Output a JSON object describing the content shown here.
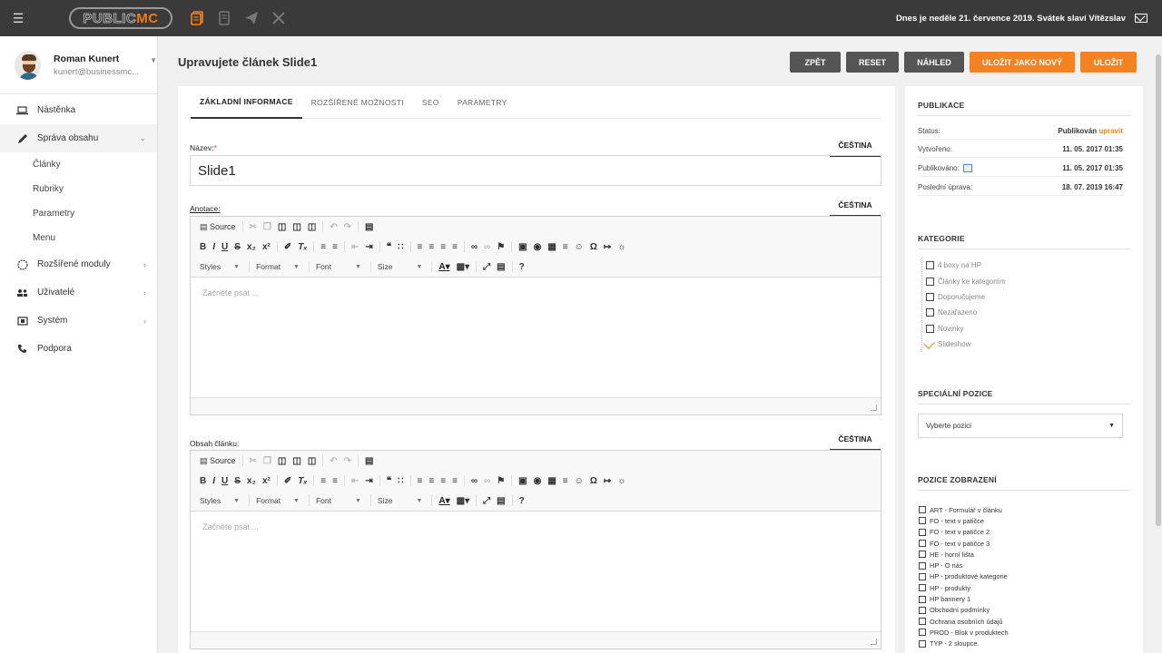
{
  "topbar": {
    "logo_part1": "PUBLIC",
    "logo_part2": "MC",
    "date_text": "Dnes je neděle 21. července 2019. Svátek slaví Vítězslav",
    "accent": "#f58220"
  },
  "user": {
    "name": "Roman Kunert",
    "email": "kunert@businessmc..."
  },
  "sidebar": {
    "items": [
      {
        "label": "Nástěnka",
        "icon": "laptop-icon"
      },
      {
        "label": "Správa obsahu",
        "icon": "pencil-icon"
      },
      {
        "label": "Rozšířené moduly",
        "icon": "modules-icon"
      },
      {
        "label": "Uživatelé",
        "icon": "users-icon"
      },
      {
        "label": "Systém",
        "icon": "system-icon"
      },
      {
        "label": "Podpora",
        "icon": "phone-icon"
      }
    ],
    "subitems": [
      "Články",
      "Rubriky",
      "Parametry",
      "Menu"
    ]
  },
  "header": {
    "title": "Upravujete článek Slide1",
    "buttons": {
      "back": "ZPĚT",
      "reset": "RESET",
      "preview": "NÁHLED",
      "save_new": "ULOŽIT JAKO NOVÝ",
      "save": "ULOŽIT"
    }
  },
  "tabs": [
    "ZÁKLADNÍ INFORMACE",
    "ROZŠÍŘENÉ MOŽNOSTI",
    "SEO",
    "PARAMETRY"
  ],
  "form": {
    "name_label": "Název:",
    "name_required": "*",
    "name_value": "Slide1",
    "annotation_label": "Anotace:",
    "content_label": "Obsah článku:",
    "language": "ČEŠTINA",
    "editor_placeholder": "Začněte psát ...",
    "toolbar": {
      "source": "Source",
      "styles": "Styles",
      "format": "Format",
      "font": "Font",
      "size": "Size"
    }
  },
  "publication": {
    "heading": "PUBLIKACE",
    "status_label": "Status:",
    "status_value": "Publikován",
    "status_link": "upravit",
    "created_label": "Vytvořeno:",
    "created_value": "11. 05. 2017 01:35",
    "published_label": "Publikováno:",
    "published_value": "11. 05. 2017 01:35",
    "modified_label": "Poslední úprava:",
    "modified_value": "18. 07. 2019 16:47"
  },
  "categories": {
    "heading": "KATEGORIE",
    "items": [
      {
        "label": "4 boxy na HP",
        "checked": false
      },
      {
        "label": "Články ke kategoriím",
        "checked": false
      },
      {
        "label": "Doporučujeme",
        "checked": false
      },
      {
        "label": "Nezařazeno",
        "checked": false
      },
      {
        "label": "Novinky",
        "checked": false
      },
      {
        "label": "Slideshow",
        "checked": true
      }
    ]
  },
  "special": {
    "heading": "SPECIÁLNÍ POZICE",
    "select_value": "Vyberte pozici"
  },
  "positions": {
    "heading": "POZICE ZOBRAZENÍ",
    "items": [
      "ART - Formulář v článku",
      "FO - text v patičce",
      "FO - text v patičce 2",
      "FO - text v patičce 3",
      "HE - horní lišta",
      "HP - O nás",
      "HP - produktové kategorie",
      "HP - produkty",
      "HP bannery 1",
      "Obchodní podmínky",
      "Ochrana osobních údajů",
      "PROD - Blok v produktech",
      "TYP - 2 sloupce"
    ]
  }
}
